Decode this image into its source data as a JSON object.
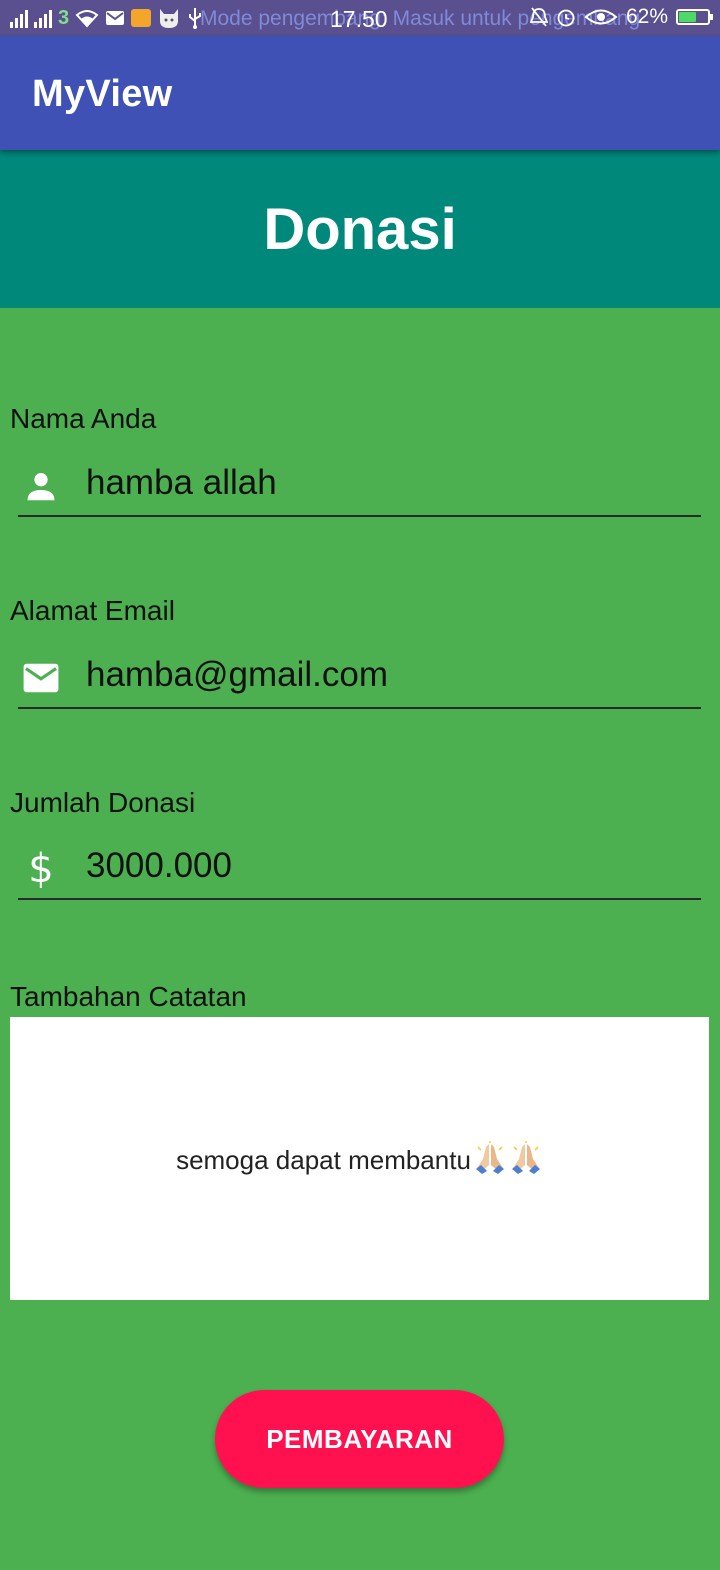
{
  "status_bar": {
    "notification_text": "Mode pengembang: Masuk untuk pengembang",
    "time": "17.50",
    "battery_text": "62%",
    "battery_level_percent": 62,
    "colors": {
      "background": "#5a4f8f",
      "battery_fill": "#4cd964"
    }
  },
  "app_bar": {
    "title": "MyView",
    "color": "#3F51B5"
  },
  "header": {
    "title": "Donasi",
    "color": "#00897B"
  },
  "form": {
    "background": "#4CAF50",
    "name": {
      "label": "Nama Anda",
      "value": "hamba allah",
      "icon": "person-icon"
    },
    "email": {
      "label": "Alamat Email",
      "value": "hamba@gmail.com",
      "icon": "email-icon"
    },
    "amount": {
      "label": "Jumlah Donasi",
      "value": "3000.000",
      "icon": "dollar-icon"
    },
    "notes": {
      "label": "Tambahan Catatan",
      "value": "semoga dapat membantu",
      "emoji": [
        "praying-hands-icon",
        "praying-hands-icon"
      ]
    }
  },
  "pay_button": {
    "label": "PEMBAYARAN",
    "color": "#FF1150"
  }
}
